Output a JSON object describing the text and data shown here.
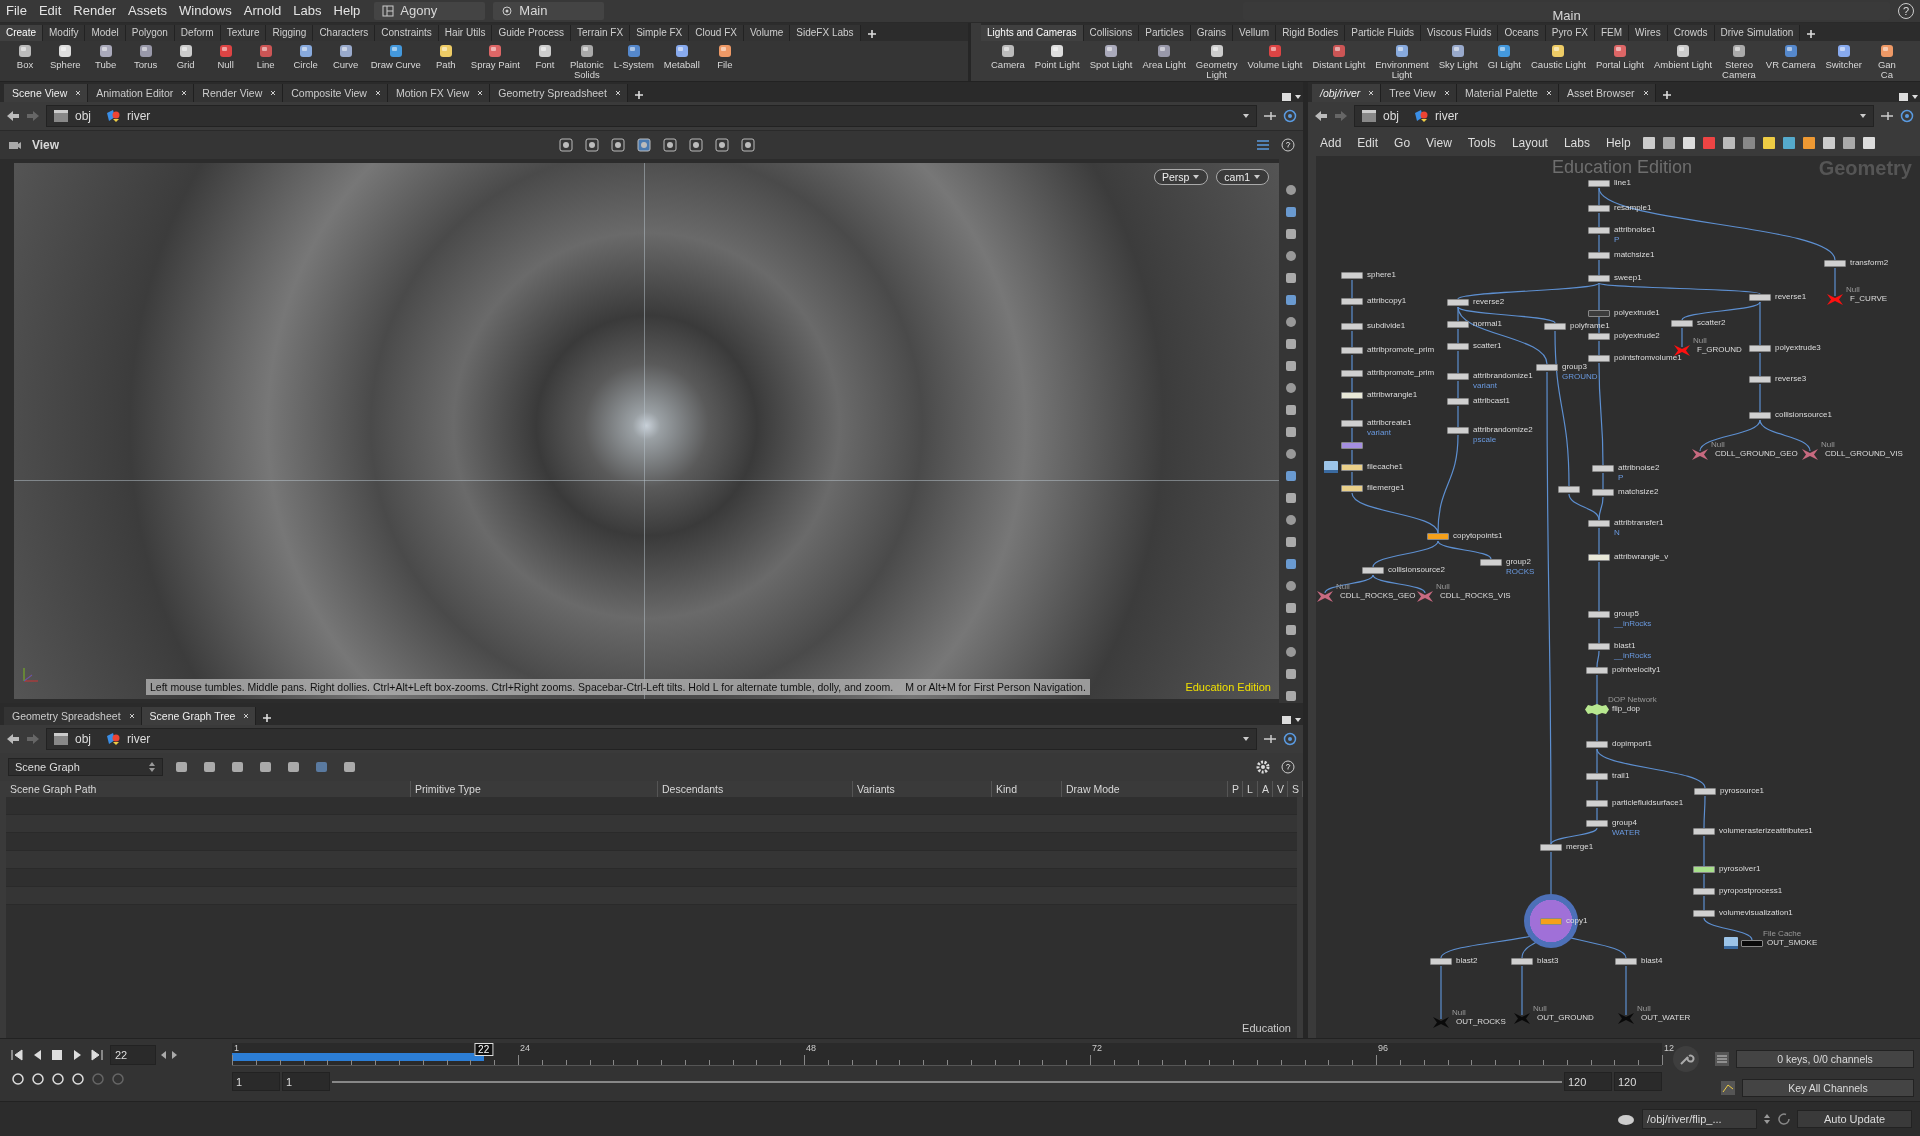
{
  "menu_bar": {
    "items": [
      "File",
      "Edit",
      "Render",
      "Assets",
      "Windows",
      "Arnold",
      "Labs",
      "Help"
    ],
    "desktop": "Agony",
    "context": "Main",
    "right_desktop": "Main",
    "help": "?"
  },
  "shelves": [
    {
      "tabs": [
        {
          "label": "Create",
          "selected": true
        },
        {
          "label": "Modify",
          "selected": false
        },
        {
          "label": "Model",
          "selected": false
        },
        {
          "label": "Polygon",
          "selected": false
        },
        {
          "label": "Deform",
          "selected": false
        },
        {
          "label": "Texture",
          "selected": false
        },
        {
          "label": "Rigging",
          "selected": false
        },
        {
          "label": "Characters",
          "selected": false
        },
        {
          "label": "Constraints",
          "selected": false
        },
        {
          "label": "Hair Utils",
          "selected": false
        },
        {
          "label": "Guide Process",
          "selected": false
        },
        {
          "label": "Terrain FX",
          "selected": false
        },
        {
          "label": "Simple FX",
          "selected": false
        },
        {
          "label": "Cloud FX",
          "selected": false
        },
        {
          "label": "Volume",
          "selected": false
        },
        {
          "label": "SideFX Labs",
          "selected": false
        }
      ],
      "tools": [
        "Box",
        "Sphere",
        "Tube",
        "Torus",
        "Grid",
        "Null",
        "Line",
        "Circle",
        "Curve",
        "Draw Curve",
        "Path",
        "Spray Paint",
        "Font",
        "Platonic\nSolids",
        "L-System",
        "Metaball",
        "File"
      ]
    },
    {
      "tabs": [
        {
          "label": "Lights and Cameras",
          "selected": true
        },
        {
          "label": "Collisions",
          "selected": false
        },
        {
          "label": "Particles",
          "selected": false
        },
        {
          "label": "Grains",
          "selected": false
        },
        {
          "label": "Vellum",
          "selected": false
        },
        {
          "label": "Rigid Bodies",
          "selected": false
        },
        {
          "label": "Particle Fluids",
          "selected": false
        },
        {
          "label": "Viscous Fluids",
          "selected": false
        },
        {
          "label": "Oceans",
          "selected": false
        },
        {
          "label": "Pyro FX",
          "selected": false
        },
        {
          "label": "FEM",
          "selected": false
        },
        {
          "label": "Wires",
          "selected": false
        },
        {
          "label": "Crowds",
          "selected": false
        },
        {
          "label": "Drive Simulation",
          "selected": false
        }
      ],
      "tools": [
        "Camera",
        "Point Light",
        "Spot Light",
        "Area Light",
        "Geometry\nLight",
        "Volume Light",
        "Distant Light",
        "Environment\nLight",
        "Sky Light",
        "GI Light",
        "Caustic Light",
        "Portal Light",
        "Ambient Light",
        "Stereo\nCamera",
        "VR Camera",
        "Switcher",
        "Gan\nCa"
      ]
    }
  ],
  "scene_pane": {
    "tabs": [
      {
        "label": "Scene View",
        "selected": true
      },
      {
        "label": "Animation Editor",
        "selected": false
      },
      {
        "label": "Render View",
        "selected": false
      },
      {
        "label": "Composite View",
        "selected": false
      },
      {
        "label": "Motion FX View",
        "selected": false
      },
      {
        "label": "Geometry Spreadsheet",
        "selected": false
      }
    ],
    "path": [
      "obj",
      "river"
    ],
    "view_label": "View",
    "camera_buttons": [
      "Persp",
      "cam1"
    ],
    "hint": "Left mouse tumbles. Middle pans. Right dollies. Ctrl+Alt+Left box-zooms. Ctrl+Right zooms. Spacebar-Ctrl-Left tilts. Hold L for alternate tumble, dolly, and zoom.",
    "hint_2": "M or Alt+M for First Person Navigation.",
    "edition": "Education Edition"
  },
  "lower_pane": {
    "tabs": [
      {
        "label": "Geometry Spreadsheet",
        "selected": false
      },
      {
        "label": "Scene Graph Tree",
        "selected": true
      }
    ],
    "path": [
      "obj",
      "river"
    ],
    "mode": "Scene Graph",
    "columns": [
      "Scene Graph Path",
      "Primitive Type",
      "Descendants",
      "Variants",
      "Kind",
      "Draw Mode",
      "P",
      "L",
      "A",
      "V",
      "S"
    ],
    "edition": "Education"
  },
  "network_pane": {
    "tabs": [
      {
        "label": "/obj/river",
        "selected": true
      },
      {
        "label": "Tree View",
        "selected": false
      },
      {
        "label": "Material Palette",
        "selected": false
      },
      {
        "label": "Asset Browser",
        "selected": false
      }
    ],
    "path": [
      "obj",
      "river"
    ],
    "menu": [
      "Add",
      "Edit",
      "Go",
      "View",
      "Tools",
      "Layout",
      "Labs",
      "Help"
    ],
    "watermark": "Education Edition",
    "context_label": "Geometry",
    "nodes": [
      {
        "name": "line1",
        "kind": "box",
        "color": "#d0d0d0",
        "display_flag": false
      },
      {
        "name": "resample1",
        "kind": "box",
        "color": "#d0d0d0",
        "display_flag": false
      },
      {
        "name": "attribnoise1",
        "kind": "box",
        "color": "#d0d0d0",
        "display_flag": false,
        "comment": "P"
      },
      {
        "name": "matchsize1",
        "kind": "box",
        "color": "#d0d0d0",
        "display_flag": false
      },
      {
        "name": "sweep1",
        "kind": "box",
        "color": "#d0d0d0",
        "display_flag": false
      },
      {
        "name": "transform2",
        "kind": "box",
        "color": "#d0d0d0",
        "display_flag": false
      },
      {
        "name": "F_CURVE",
        "kind": "null",
        "type": "Null",
        "color": "#ff1010",
        "display_flag": false
      },
      {
        "name": "sphere1",
        "kind": "box",
        "color": "#d0d0d0",
        "display_flag": false
      },
      {
        "name": "attribcopy1",
        "kind": "box",
        "color": "#d0d0d0",
        "display_flag": false
      },
      {
        "name": "subdivide1",
        "kind": "box",
        "color": "#d0d0d0",
        "display_flag": false
      },
      {
        "name": "attribpromote_prim",
        "kind": "box",
        "color": "#d0d0d0",
        "display_flag": false
      },
      {
        "name": "attribpromote_prim",
        "kind": "box",
        "color": "#d0d0d0",
        "display_flag": false
      },
      {
        "name": "attribwrangle1",
        "kind": "box",
        "color": "#e8e8d8",
        "display_flag": false
      },
      {
        "name": "attribcreate1",
        "kind": "box",
        "color": "#d0d0d0",
        "display_flag": false,
        "comment": "variant"
      },
      {
        "kind": "box",
        "color": "#a58fe0",
        "display_flag": false
      },
      {
        "name": "filecache1",
        "kind": "cache",
        "color": "#ead08a",
        "display_flag": false
      },
      {
        "name": "filemerge1",
        "kind": "box",
        "color": "#ead08a",
        "display_flag": false
      },
      {
        "name": "reverse2",
        "kind": "box",
        "color": "#d0d0d0",
        "display_flag": false
      },
      {
        "name": "normal1",
        "kind": "box",
        "color": "#d0d0d0",
        "display_flag": false
      },
      {
        "name": "scatter1",
        "kind": "box",
        "color": "#d0d0d0",
        "display_flag": false
      },
      {
        "name": "attribrandomize1",
        "kind": "box",
        "color": "#d0d0d0",
        "display_flag": false,
        "comment": "variant"
      },
      {
        "name": "attribcast1",
        "kind": "box",
        "color": "#d0d0d0",
        "display_flag": false
      },
      {
        "name": "attribrandomize2",
        "kind": "box",
        "color": "#d0d0d0",
        "display_flag": false,
        "comment": "pscale"
      },
      {
        "name": "polyframe1",
        "kind": "box",
        "color": "#d0d0d0",
        "display_flag": false
      },
      {
        "name": "group3",
        "kind": "box",
        "color": "#d0d0d0",
        "display_flag": false,
        "comment": "GROUND"
      },
      {
        "name": "polyextrude1",
        "kind": "box",
        "color": "#3c3c3c",
        "display_flag": false
      },
      {
        "name": "polyextrude2",
        "kind": "box",
        "color": "#d0d0d0",
        "display_flag": false
      },
      {
        "name": "pointsfromvolume1",
        "kind": "box",
        "color": "#d0d0d0",
        "display_flag": false
      },
      {
        "name": "reverse1",
        "kind": "box",
        "color": "#d0d0d0",
        "display_flag": false
      },
      {
        "name": "scatter2",
        "kind": "box",
        "color": "#d0d0d0",
        "display_flag": false
      },
      {
        "name": "F_GROUND",
        "kind": "null",
        "type": "Null",
        "color": "#ff1010",
        "display_flag": false
      },
      {
        "name": "polyextrude3",
        "kind": "box",
        "color": "#d0d0d0",
        "display_flag": false
      },
      {
        "name": "reverse3",
        "kind": "box",
        "color": "#d0d0d0",
        "display_flag": false
      },
      {
        "name": "collisionsource1",
        "kind": "box",
        "color": "#d0d0d0",
        "display_flag": false
      },
      {
        "name": "CDLL_GROUND_GEO",
        "kind": "null",
        "type": "Null",
        "color": "#c86a80",
        "display_flag": false
      },
      {
        "name": "CDLL_GROUND_VIS",
        "kind": "null",
        "type": "Null",
        "color": "#c86a80",
        "display_flag": false
      },
      {
        "name": "copytopoints1",
        "kind": "box",
        "color": "#f5a01a",
        "display_flag": false
      },
      {
        "name": "collisionsource2",
        "kind": "box",
        "color": "#d0d0d0",
        "display_flag": false
      },
      {
        "name": "group2",
        "kind": "box",
        "color": "#d0d0d0",
        "display_flag": false,
        "comment": "ROCKS"
      },
      {
        "name": "CDLL_ROCKS_GEO",
        "kind": "null",
        "type": "Null",
        "color": "#c86a80",
        "display_flag": false
      },
      {
        "name": "CDLL_ROCKS_VIS",
        "kind": "null",
        "type": "Null",
        "color": "#c86a80",
        "display_flag": false
      },
      {
        "name": "attribnoise2",
        "kind": "box",
        "color": "#d0d0d0",
        "display_flag": false,
        "comment": "P"
      },
      {
        "kind": "box",
        "color": "#d0d0d0",
        "display_flag": false
      },
      {
        "name": "matchsize2",
        "kind": "box",
        "color": "#d0d0d0",
        "display_flag": false
      },
      {
        "name": "attribtransfer1",
        "kind": "box",
        "color": "#d0d0d0",
        "display_flag": false,
        "comment": "N"
      },
      {
        "name": "attribwrangle_v",
        "kind": "box",
        "color": "#e8e8d8",
        "display_flag": false
      },
      {
        "name": "group5",
        "kind": "box",
        "color": "#d0d0d0",
        "display_flag": false,
        "comment": "__inRocks"
      },
      {
        "name": "blast1",
        "kind": "box",
        "color": "#d0d0d0",
        "display_flag": false,
        "comment": "__inRocks"
      },
      {
        "name": "pointvelocity1",
        "kind": "box",
        "color": "#d0d0d0",
        "display_flag": false
      },
      {
        "name": "flip_dop",
        "kind": "dop",
        "type": "DOP Network",
        "color": "#b8e890",
        "display_flag": false
      },
      {
        "name": "dopimport1",
        "kind": "box",
        "color": "#d0d0d0",
        "display_flag": false
      },
      {
        "name": "trail1",
        "kind": "box",
        "color": "#d0d0d0",
        "display_flag": false
      },
      {
        "name": "particlefluidsurface1",
        "kind": "box",
        "color": "#d0d0d0",
        "display_flag": false
      },
      {
        "name": "group4",
        "kind": "box",
        "color": "#d0d0d0",
        "display_flag": false,
        "comment": "WATER"
      },
      {
        "name": "merge1",
        "kind": "box",
        "color": "#d0d0d0",
        "display_flag": false
      },
      {
        "name": "copy1",
        "kind": "box",
        "color": "#f5a01a",
        "display_flag": true
      },
      {
        "name": "blast2",
        "kind": "box",
        "color": "#d0d0d0",
        "display_flag": false
      },
      {
        "name": "blast3",
        "kind": "box",
        "color": "#d0d0d0",
        "display_flag": false
      },
      {
        "name": "blast4",
        "kind": "box",
        "color": "#d0d0d0",
        "display_flag": false
      },
      {
        "name": "OUT_ROCKS",
        "kind": "null",
        "type": "Null",
        "color": "#0a0a0a",
        "display_flag": false
      },
      {
        "name": "OUT_GROUND",
        "kind": "null",
        "type": "Null",
        "color": "#0a0a0a",
        "display_flag": false
      },
      {
        "name": "OUT_WATER",
        "kind": "null",
        "type": "Null",
        "color": "#0a0a0a",
        "display_flag": false
      },
      {
        "name": "pyrosource1",
        "kind": "box",
        "color": "#d0d0d0",
        "display_flag": false
      },
      {
        "name": "volumerasterizeattributes1",
        "kind": "box",
        "color": "#d0d0d0",
        "display_flag": false
      },
      {
        "name": "pyrosolver1",
        "kind": "box",
        "color": "#a8e08c",
        "display_flag": false
      },
      {
        "name": "pyropostprocess1",
        "kind": "box",
        "color": "#d0d0d0",
        "display_flag": false
      },
      {
        "name": "volumevisualization1",
        "kind": "box",
        "color": "#d0d0d0",
        "display_flag": false
      },
      {
        "name": "OUT_SMOKE",
        "kind": "cache",
        "type": "File Cache",
        "color": "#0a0a0a",
        "display_flag": false
      }
    ]
  },
  "timeline": {
    "range": {
      "level": 1
    },
    "frame": "22",
    "current_frame_label": "22",
    "level": 0.176,
    "ticks": [
      "1",
      "24",
      "48",
      "72",
      "96",
      "12"
    ],
    "start": "1",
    "start_2": "1",
    "end": "120",
    "end_2": "120",
    "keys": "0 keys, 0/0 channels",
    "key_all": "Key All Channels"
  },
  "status_bar": {
    "path": "/obj/river/flip_...",
    "update_mode": "Auto Update"
  }
}
